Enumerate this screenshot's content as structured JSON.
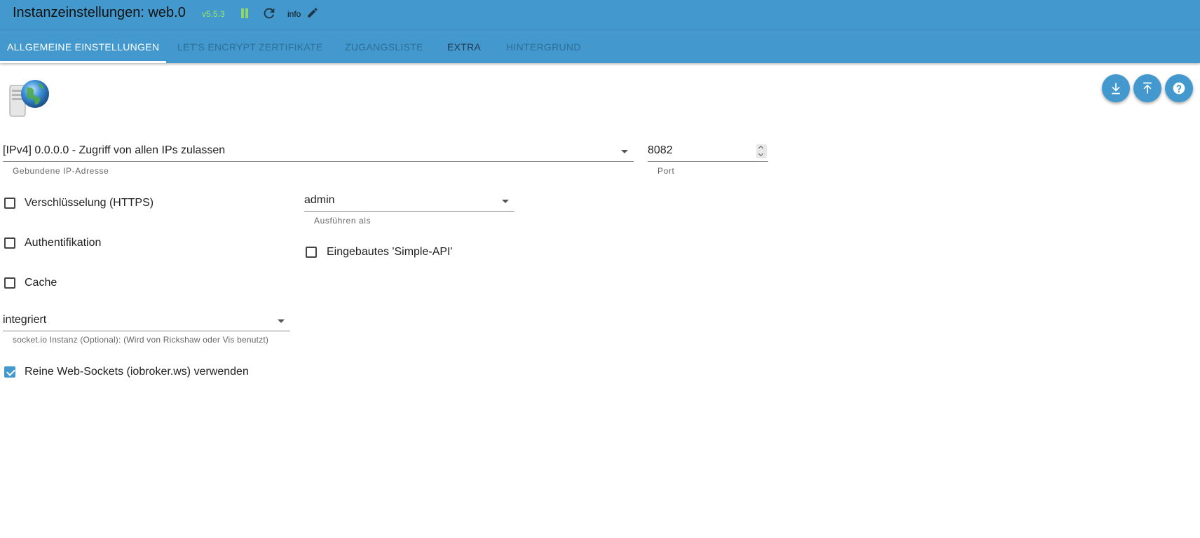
{
  "header": {
    "title": "Instanzeinstellungen: web.0",
    "version": "v5.5.3",
    "pause_icon": "pause-icon",
    "reload_icon": "reload-icon",
    "info_label": "info",
    "edit_icon": "pencil-icon",
    "colors": {
      "bar": "#4399cd",
      "version": "#97e56b",
      "pause": "#8fd66a"
    }
  },
  "tabs": [
    {
      "label": "ALLGEMEINE EINSTELLUNGEN",
      "active": true
    },
    {
      "label": "LET'S ENCRYPT ZERTIFIKATE",
      "active": false
    },
    {
      "label": "ZUGANGSLISTE",
      "active": false
    },
    {
      "label": "EXTRA",
      "active": false
    },
    {
      "label": "HINTERGRUND",
      "active": false
    }
  ],
  "actions": {
    "download_icon": "download-icon",
    "upload_icon": "upload-icon",
    "help_icon": "help-icon"
  },
  "form": {
    "bind_ip": {
      "value": "[IPv4] 0.0.0.0 - Zugriff von allen IPs zulassen",
      "helper": "Gebundene IP-Adresse"
    },
    "port": {
      "value": "8082",
      "helper": "Port"
    },
    "https": {
      "label": "Verschlüsselung (HTTPS)",
      "checked": false
    },
    "run_as": {
      "value": "admin",
      "helper": "Ausführen als"
    },
    "auth": {
      "label": "Authentifikation",
      "checked": false
    },
    "simple_api": {
      "label": "Eingebautes 'Simple-API'",
      "checked": false
    },
    "cache": {
      "label": "Cache",
      "checked": false
    },
    "socketio": {
      "value": "integriert",
      "helper": "socket.io Instanz (Optional): (Wird von Rickshaw oder Vis benutzt)"
    },
    "web_sockets": {
      "label": "Reine Web-Sockets (iobroker.ws) verwenden",
      "checked": true
    }
  }
}
